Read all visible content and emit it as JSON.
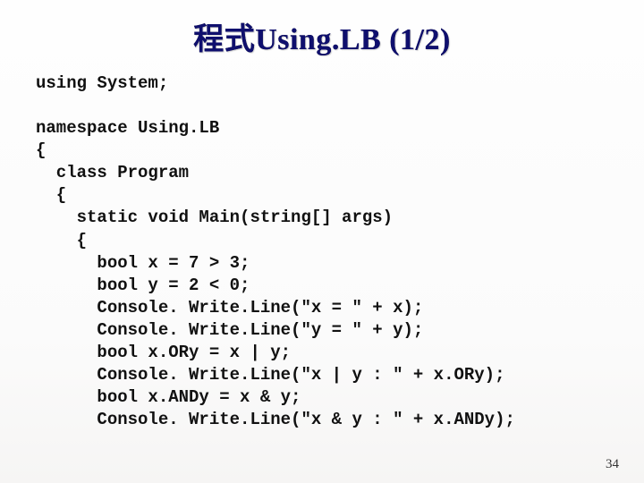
{
  "slide": {
    "title": "程式Using.LB (1/2)",
    "page_number": "34"
  },
  "code": {
    "lines": [
      "using System;",
      "",
      "namespace Using.LB",
      "{",
      "  class Program",
      "  {",
      "    static void Main(string[] args)",
      "    {",
      "      bool x = 7 > 3;",
      "      bool y = 2 < 0;",
      "      Console. Write.Line(\"x = \" + x);",
      "      Console. Write.Line(\"y = \" + y);",
      "      bool x.ORy = x | y;",
      "      Console. Write.Line(\"x | y : \" + x.ORy);",
      "      bool x.ANDy = x & y;",
      "      Console. Write.Line(\"x & y : \" + x.ANDy);"
    ]
  }
}
